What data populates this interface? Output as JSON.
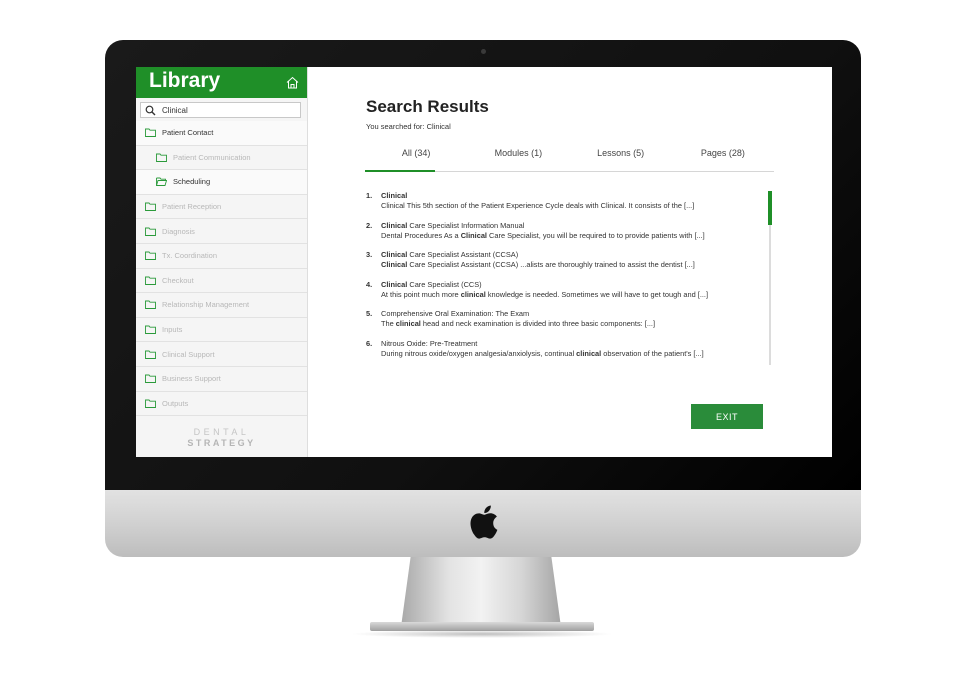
{
  "sidebar": {
    "title": "Library",
    "search_value": "Clinical",
    "items": [
      {
        "label": "Patient Contact",
        "level": 0,
        "active": true
      },
      {
        "label": "Patient Communication",
        "level": 1,
        "active": false
      },
      {
        "label": "Scheduling",
        "level": 1,
        "active": true
      },
      {
        "label": "Patient Reception",
        "level": 0,
        "active": false
      },
      {
        "label": "Diagnosis",
        "level": 0,
        "active": false
      },
      {
        "label": "Tx. Coordination",
        "level": 0,
        "active": false
      },
      {
        "label": "Checkout",
        "level": 0,
        "active": false
      },
      {
        "label": "Relationship Management",
        "level": 0,
        "active": false
      },
      {
        "label": "Inputs",
        "level": 0,
        "active": false
      },
      {
        "label": "Clinical Support",
        "level": 0,
        "active": false
      },
      {
        "label": "Business Support",
        "level": 0,
        "active": false
      },
      {
        "label": "Outputs",
        "level": 0,
        "active": false
      }
    ],
    "brand_top": "DENTAL",
    "brand_bottom": "STRATEGY"
  },
  "main": {
    "title": "Search Results",
    "caption": "You searched for: Clinical",
    "tabs": [
      {
        "label": "All (34)",
        "active": true
      },
      {
        "label": "Modules (1)",
        "active": false
      },
      {
        "label": "Lessons (5)",
        "active": false
      },
      {
        "label": "Pages (28)",
        "active": false
      }
    ],
    "results": [
      {
        "num": "1.",
        "title": "<b>Clinical</b>",
        "snippet": "Clinical This 5th section of the Patient Experience Cycle deals with Clinical.  It consists of the [...]"
      },
      {
        "num": "2.",
        "title": "<b>Clinical</b> Care Specialist Information Manual",
        "snippet": "Dental Procedures As a <b>Clinical</b> Care Specialist, you will be required to to provide patients with [...]"
      },
      {
        "num": "3.",
        "title": "<b>Clinical</b> Care Specialist Assistant (CCSA)",
        "snippet": "<b>Clinical</b> Care Specialist Assistant (CCSA) ...alists are thoroughly trained to assist the dentist  [...]"
      },
      {
        "num": "4.",
        "title": "<b>Clinical</b> Care Specialist (CCS)",
        "snippet": "At this point much more <b>clinical</b> knowledge is needed. Sometimes we will have  to get tough and  [...]"
      },
      {
        "num": "5.",
        "title": "Comprehensive Oral Examination: The Exam",
        "snippet": "The <b>clinical</b> head and neck examination is divided into three basic components: [...]"
      },
      {
        "num": "6.",
        "title": "Nitrous Oxide: Pre-Treatment",
        "snippet": "During nitrous oxide/oxygen analgesia/anxiolysis, continual <b>clinical</b> observation of the patient's [...]"
      }
    ],
    "exit_label": "EXIT"
  },
  "colors": {
    "accent_green": "#1f8f28",
    "button_green": "#2a8c3a"
  }
}
